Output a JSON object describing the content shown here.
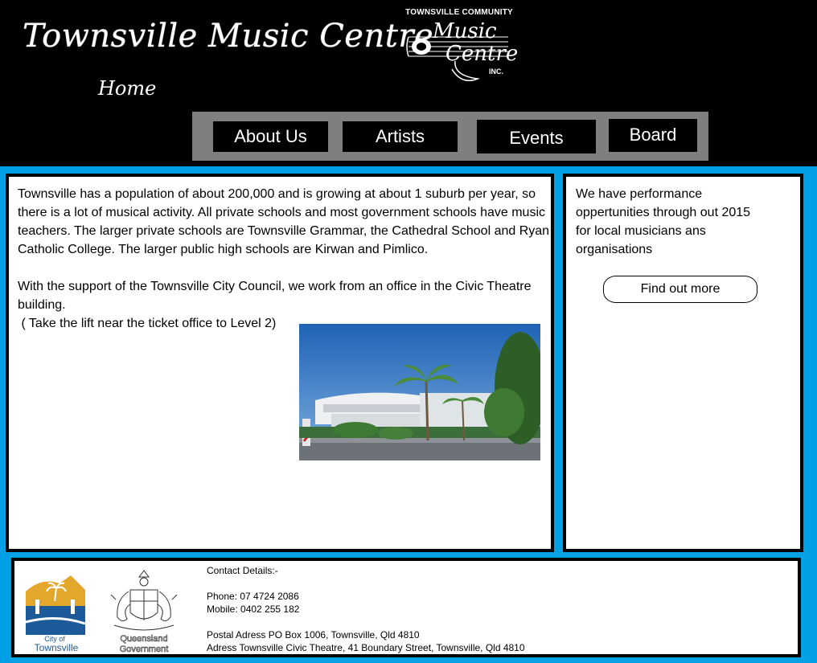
{
  "header": {
    "site_title": "Townsville Music Centre",
    "page_subtitle": "Home",
    "logo": {
      "top_text": "TOWNSVILLE COMMUNITY",
      "line1": "Music",
      "line2": "Centre",
      "suffix": "INC."
    }
  },
  "nav": {
    "items": [
      {
        "label": "About Us"
      },
      {
        "label": "Artists"
      },
      {
        "label": "Events"
      },
      {
        "label": "Board"
      }
    ]
  },
  "main": {
    "paragraph1": "Townsville has a population of about 200,000 and is growing at about 1 suburb per year, so there is a lot of musical activity. All private schools and most government schools have music teachers. The larger private schools are Townsville Grammar, the Cathedral School and Ryan Catholic College. The larger public high schools are Kirwan and Pimlico.",
    "paragraph2": "With the support of the Townsville City Council, we work from an office in the Civic Theatre building.",
    "paragraph3": " ( Take the lift near the ticket office to Level 2)"
  },
  "side": {
    "text": "We have performance oppertunities through out 2015 for local musicians ans organisations",
    "button_label": "Find out more"
  },
  "footer": {
    "contact_heading": "Contact Details:-",
    "phone": "Phone: 07 4724 2086",
    "mobile": "Mobile: 0402 255 182",
    "postal": "Postal Adress PO Box 1006, Townsville, Qld 4810",
    "address": "Adress Townsville Civic Theatre, 41 Boundary Street, Townsville, Qld 4810",
    "council_logo": {
      "line1": "City of",
      "line2": "Townsville"
    },
    "qld_logo": {
      "line1": "Queensland",
      "line2": "Government"
    }
  },
  "colors": {
    "header_bg": "#000000",
    "nav_bar": "#7f7f7f",
    "page_bg": "#00a0e4",
    "panel_bg": "#ffffff",
    "council_gold": "#e3a82b",
    "council_blue": "#1d5a9a"
  }
}
